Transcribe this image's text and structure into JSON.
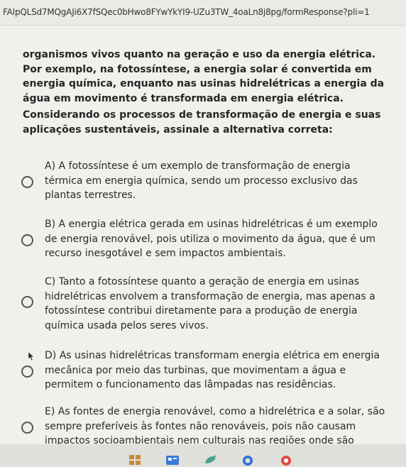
{
  "browser": {
    "url": "FAIpQLSd7MQgAJi6X7fSQec0bHwo8FYwYkYI9-UZu3TW_4oaLn8j8pg/formResponse?pli=1"
  },
  "question": {
    "intro_lines": [
      "organismos vivos quanto na geração e uso da energia elétrica.",
      "Por exemplo, na fotossíntese, a energia solar é convertida em",
      "energia química, enquanto nas usinas hidrelétricas a energia da",
      "água em movimento é transformada em energia elétrica."
    ],
    "prompt_lines": [
      "Considerando os processos de transformação de energia e suas",
      "aplicações sustentáveis, assinale a alternativa correta:"
    ]
  },
  "options": [
    {
      "letter": "A",
      "lines": [
        "A) A fotossíntese é um exemplo de transformação de energia",
        "térmica em energia química, sendo um processo exclusivo das",
        "plantas terrestres."
      ]
    },
    {
      "letter": "B",
      "lines": [
        "B) A energia elétrica gerada em usinas hidrelétricas é um exemplo",
        "de energia renovável, pois utiliza o movimento da água, que é um",
        "recurso inesgotável e sem impactos ambientais."
      ]
    },
    {
      "letter": "C",
      "lines": [
        "C) Tanto a fotossíntese quanto a geração de energia em usinas",
        "hidrelétricas envolvem a transformação de energia, mas apenas a",
        "fotossíntese contribui diretamente para a produção de energia",
        "química usada pelos seres vivos."
      ]
    },
    {
      "letter": "D",
      "lines": [
        "D) As usinas hidrelétricas transformam energia elétrica em energia",
        "mecânica por meio das turbinas, que movimentam a água e",
        "permitem o funcionamento das lâmpadas nas residências."
      ]
    },
    {
      "letter": "E",
      "lines": [
        "E) As fontes de energia renovável, como a hidrelétrica e a solar, são",
        "sempre preferíveis às fontes não renováveis, pois não causam",
        "impactos socioambientais nem culturais nas regiões onde são"
      ]
    }
  ],
  "taskbar": {
    "icons": [
      "start-icon",
      "widget-icon",
      "chat-icon",
      "search-icon",
      "chrome-icon"
    ]
  }
}
